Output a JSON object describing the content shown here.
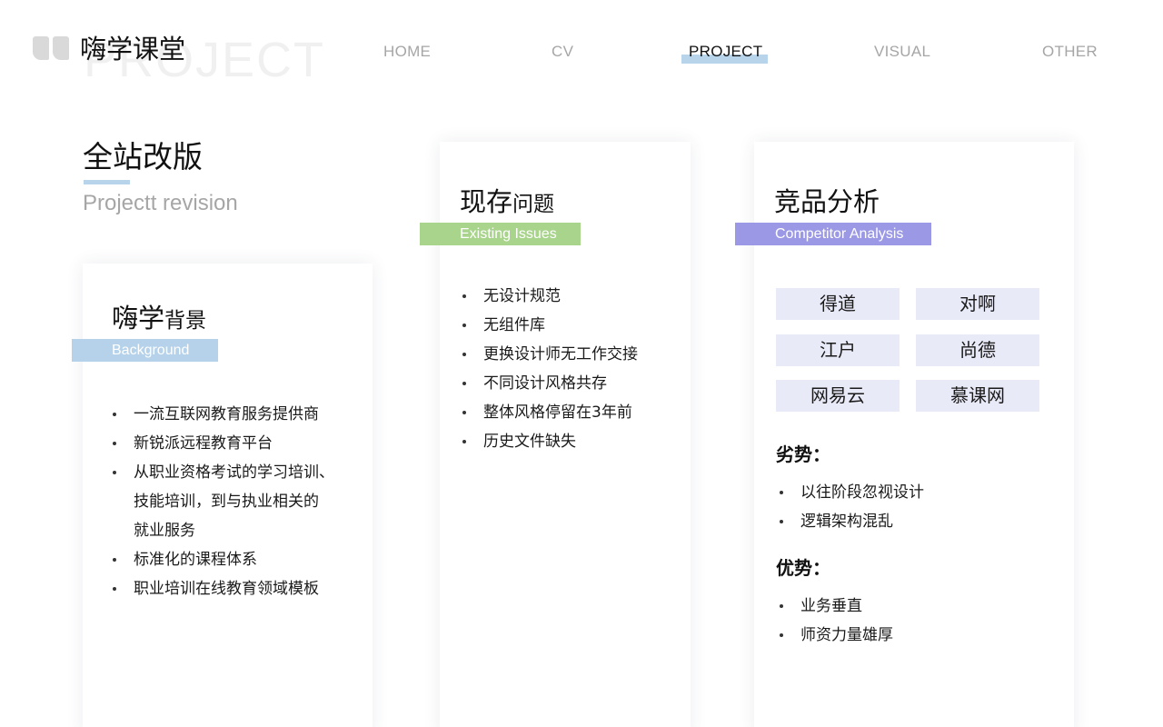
{
  "header": {
    "brand_title": "嗨学课堂",
    "brand_watermark": "PROJECT",
    "nav": [
      {
        "label": "HOME",
        "active": false
      },
      {
        "label": "CV",
        "active": false
      },
      {
        "label": "PROJECT",
        "active": true
      },
      {
        "label": "VISUAL",
        "active": false
      },
      {
        "label": "OTHER",
        "active": false
      }
    ]
  },
  "section": {
    "title": "全站改版",
    "subtitle": "Projectt revision"
  },
  "background_card": {
    "title_main": "嗨学",
    "title_small": "背景",
    "tag": "Background",
    "items": [
      "一流互联网教育服务提供商",
      "新锐派远程教育平台",
      "从职业资格考试的学习培训、",
      "技能培训，到与执业相关的",
      "就业服务",
      "标准化的课程体系",
      "职业培训在线教育领域模板"
    ]
  },
  "issues_card": {
    "title_main": "现存",
    "title_small": "问题",
    "tag": "Existing Issues",
    "items": [
      "无设计规范",
      "无组件库",
      "更换设计师无工作交接",
      "不同设计风格共存",
      "整体风格停留在3年前",
      "历史文件缺失"
    ]
  },
  "competitor_card": {
    "title": "竞品分析",
    "tag": "Competitor Analysis",
    "competitors": [
      "得道",
      "对啊",
      "江户",
      "尚德",
      "网易云",
      "慕课网"
    ],
    "weakness_label": "劣势：",
    "weaknesses": [
      "以往阶段忽视设计",
      "逻辑架构混乱"
    ],
    "strength_label": "优势：",
    "strengths": [
      "业务垂直",
      "师资力量雄厚"
    ]
  },
  "colors": {
    "accent_blue": "#b5d2ea",
    "accent_green": "#a9d48c",
    "accent_purple": "#9b98e6",
    "chip_bg": "#e9eaf8",
    "nav_inactive": "#a6a6a6"
  },
  "icons": {
    "brand": "quote-icon",
    "bullet": "bullet-dot-icon"
  }
}
